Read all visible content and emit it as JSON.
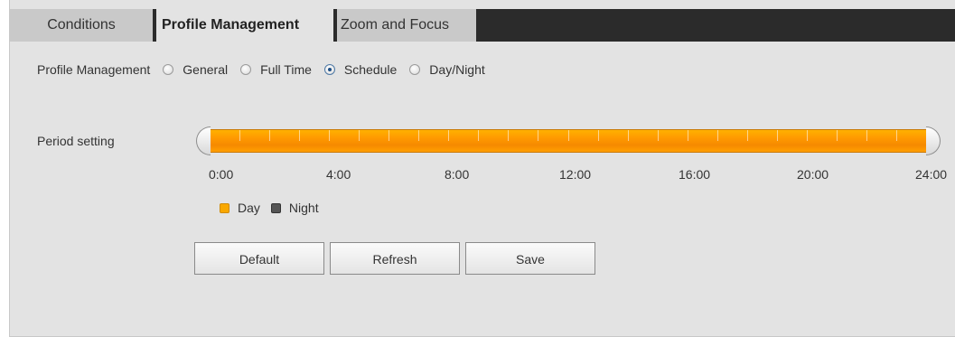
{
  "tabs": [
    {
      "label": "Conditions",
      "active": false
    },
    {
      "label": "Profile Management",
      "active": true
    },
    {
      "label": "Zoom and Focus",
      "active": false
    }
  ],
  "profile": {
    "label": "Profile Management",
    "options": [
      "General",
      "Full Time",
      "Schedule",
      "Day/Night"
    ],
    "selected": "Schedule"
  },
  "period": {
    "label": "Period setting",
    "day_start": "0:00",
    "day_end": "24:00",
    "ticks": [
      "0:00",
      "4:00",
      "8:00",
      "12:00",
      "16:00",
      "20:00",
      "24:00"
    ]
  },
  "legend": {
    "day": "Day",
    "night": "Night",
    "day_color": "#f9a800",
    "night_color": "#555555"
  },
  "buttons": {
    "default": "Default",
    "refresh": "Refresh",
    "save": "Save"
  }
}
